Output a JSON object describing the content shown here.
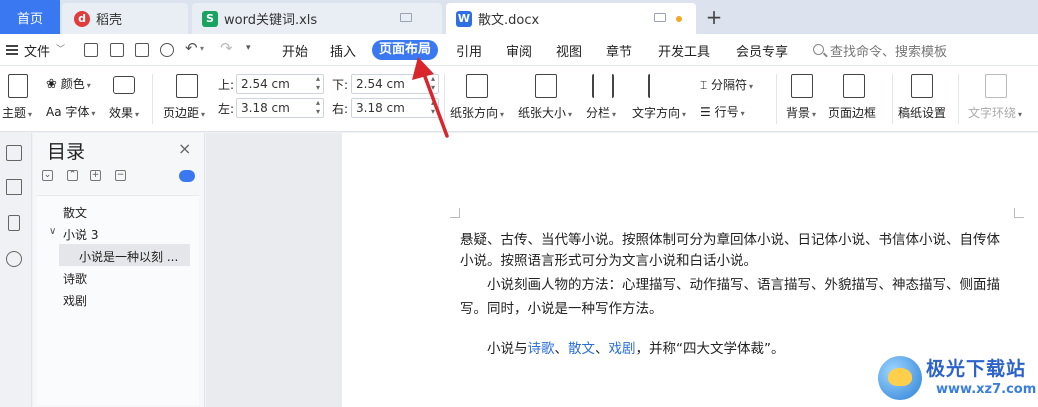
{
  "tabs": {
    "home": "首页",
    "daoke": "稻壳",
    "xls": "word关键词.xls",
    "docx": "散文.docx",
    "add": "+"
  },
  "menu": {
    "file": "文件",
    "items": [
      "开始",
      "插入",
      "页面布局",
      "引用",
      "审阅",
      "视图",
      "章节",
      "开发工具",
      "会员专享"
    ],
    "active": "页面布局",
    "search_placeholder": "查找命令、搜索模板"
  },
  "ribbon": {
    "theme": "主题",
    "color": "颜色",
    "font": "字体",
    "font_prefix": "Aa",
    "effect": "效果",
    "margins": "页边距",
    "top_label": "上:",
    "top_value": "2.54 cm",
    "bottom_label": "下:",
    "bottom_value": "2.54 cm",
    "left_label": "左:",
    "left_value": "3.18 cm",
    "right_label": "右:",
    "right_value": "3.18 cm",
    "orientation": "纸张方向",
    "size": "纸张大小",
    "columns": "分栏",
    "text_direction": "文字方向",
    "separator": "分隔符",
    "line_number": "行号",
    "background": "背景",
    "page_border": "页面边框",
    "manuscript": "稿纸设置",
    "text_wrap": "文字环绕"
  },
  "outline": {
    "title": "目录",
    "close": "×",
    "items": [
      {
        "label": "散文"
      },
      {
        "label": "小说 3"
      },
      {
        "label": "小说是一种以刻 ..."
      },
      {
        "label": "诗歌"
      },
      {
        "label": "戏剧"
      }
    ]
  },
  "document": {
    "line1": "悬疑、古传、当代等小说。按照体制可分为章回体小说、日记体小说、书信体小说、自传体",
    "line2": "小说。按照语言形式可分为文言小说和白话小说。",
    "line3": "小说刻画人物的方法：心理描写、动作描写、语言描写、外貌描写、神态描写、侧面描",
    "line4": "写。同时，小说是一种写作方法。",
    "line5_prefix": "小说与",
    "link1": "诗歌",
    "sep1": "、",
    "link2": "散文",
    "sep2": "、",
    "link3": "戏剧",
    "line5_suffix": "，并称“四大文学体裁”。"
  },
  "watermark": {
    "title": "极光下载站",
    "url": "www.xz7.com"
  }
}
